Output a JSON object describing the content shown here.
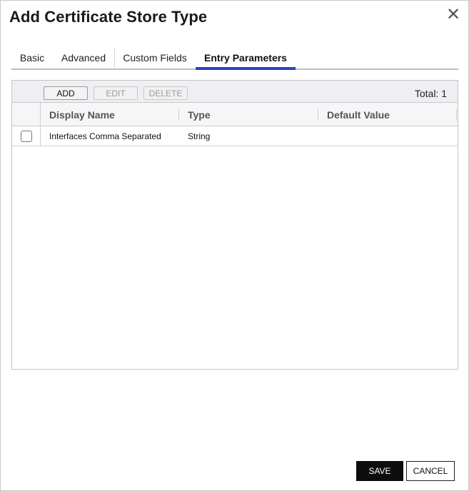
{
  "dialog": {
    "title": "Add Certificate Store Type",
    "close_glyph": "✕"
  },
  "tabs": [
    {
      "label": "Basic",
      "active": false
    },
    {
      "label": "Advanced",
      "active": false
    },
    {
      "label": "Custom Fields",
      "active": false
    },
    {
      "label": "Entry Parameters",
      "active": true
    }
  ],
  "toolbar": {
    "add_label": "ADD",
    "edit_label": "EDIT",
    "delete_label": "DELETE",
    "total_text": "Total: 1"
  },
  "table": {
    "columns": [
      "Display Name",
      "Type",
      "Default Value"
    ],
    "rows": [
      {
        "checked": false,
        "display_name": "Interfaces Comma Separated",
        "type": "String",
        "default_value": ""
      }
    ]
  },
  "footer": {
    "save_label": "SAVE",
    "cancel_label": "CANCEL"
  },
  "colors": {
    "active_tab_underline": "#2f3fbf",
    "save_button_bg": "#0d0d0d",
    "toolbar_bg": "#eeeff3"
  }
}
